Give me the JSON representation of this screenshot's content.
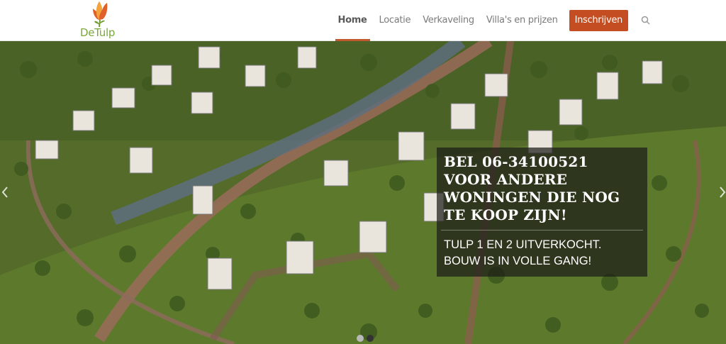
{
  "brand": {
    "name": "DeTulp"
  },
  "nav": {
    "items": [
      "Home",
      "Locatie",
      "Verkaveling",
      "Villa's en prijzen"
    ],
    "cta": "Inschrijven"
  },
  "hero": {
    "title": "BEL 06-34100521 VOOR ANDERE WONINGEN DIE NOG TE KOOP ZIJN!",
    "subtitle": "TULP 1 EN 2 UITVERKOCHT. BOUW IS IN VOLLE GANG!"
  },
  "slider": {
    "slides": 2,
    "active": 1
  },
  "icons": [
    "tulip-logo-icon",
    "search-icon",
    "chevron-left-icon",
    "chevron-right-icon"
  ],
  "colors": {
    "accent": "#c44d22",
    "logo_green": "#7aa83a"
  }
}
